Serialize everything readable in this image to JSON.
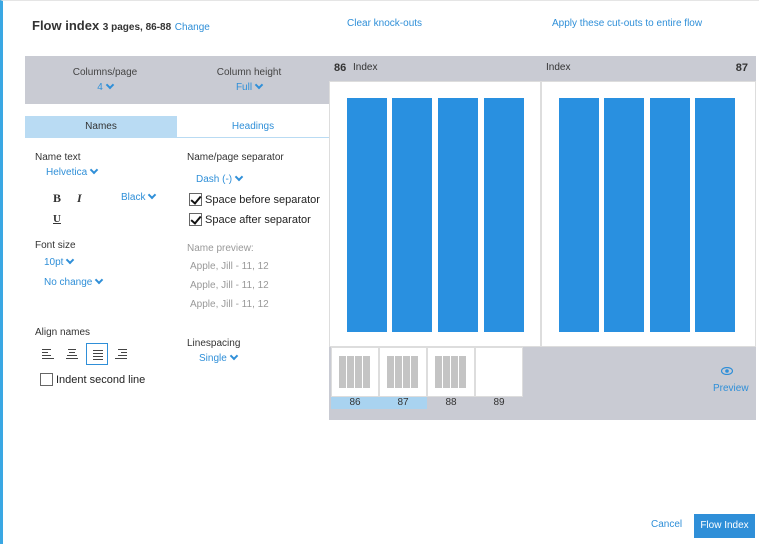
{
  "header": {
    "title": "Flow index",
    "subtitle": "3 pages, 86-88",
    "change_label": "Change",
    "clear_label": "Clear knock-outs",
    "apply_label": "Apply these cut-outs to entire flow"
  },
  "controls": {
    "columns_label": "Columns/page",
    "columns_value": "4",
    "height_label": "Column height",
    "height_value": "Full"
  },
  "tabs": {
    "names": "Names",
    "headings": "Headings"
  },
  "names_panel": {
    "name_text_label": "Name text",
    "font_value": "Helvetica",
    "bold_label": "B",
    "italic_label": "I",
    "underline_label": "U",
    "color_value": "Black",
    "font_size_label": "Font size",
    "font_size_value": "10pt",
    "change_value": "No change",
    "align_label": "Align names",
    "indent_label": "Indent second line",
    "indent_checked": false,
    "separator_label": "Name/page separator",
    "separator_value": "Dash (-)",
    "space_before_label": "Space before separator",
    "space_before_checked": true,
    "space_after_label": "Space after separator",
    "space_after_checked": true,
    "preview_label": "Name preview:",
    "preview_lines": [
      "Apple, Jill - 11, 12",
      "Apple, Jill - 11, 12",
      "Apple, Jill - 11, 12"
    ],
    "linespacing_label": "Linespacing",
    "linespacing_value": "Single"
  },
  "preview": {
    "left_page_num": "86",
    "left_page_title": "Index",
    "right_page_title": "Index",
    "right_page_num": "87",
    "thumbs": [
      {
        "num": "86",
        "cols": 4,
        "highlight": true
      },
      {
        "num": "87",
        "cols": 4,
        "highlight": true
      },
      {
        "num": "88",
        "cols": 4,
        "highlight": false
      },
      {
        "num": "89",
        "cols": 0,
        "highlight": false
      }
    ],
    "preview_label": "Preview"
  },
  "footer": {
    "cancel_label": "Cancel",
    "flow_label": "Flow Index"
  },
  "colors": {
    "accent": "#2f8fd8",
    "column_fill": "#2990e0",
    "panel_grey": "#c9cbd3",
    "tab_active": "#b9dbf3",
    "thumb_highlight": "#a9d3f0"
  }
}
